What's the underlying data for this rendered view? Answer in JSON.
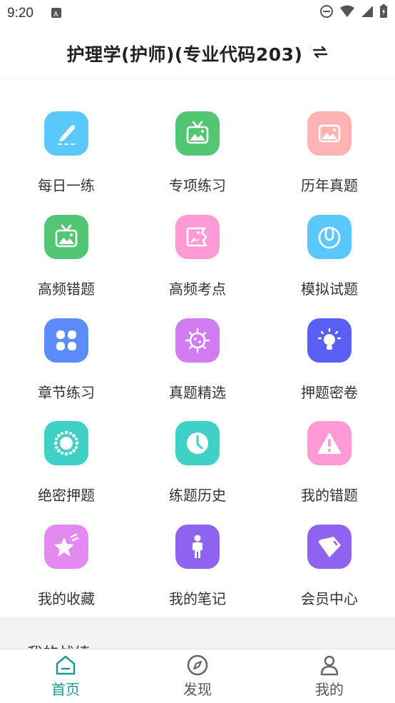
{
  "status_bar": {
    "time": "9:20"
  },
  "header": {
    "title": "护理学(护师)(专业代码203)",
    "switch_icon": "swap-arrows-icon"
  },
  "grid": [
    {
      "label": "每日一练",
      "icon": "pen-icon",
      "color": "#5ac8fa"
    },
    {
      "label": "专项练习",
      "icon": "tv-icon",
      "color": "#52c673"
    },
    {
      "label": "历年真题",
      "icon": "picture-icon",
      "color": "#ffb3b3"
    },
    {
      "label": "高频错题",
      "icon": "tv-icon",
      "color": "#52c673"
    },
    {
      "label": "高频考点",
      "icon": "broken-picture-icon",
      "color": "#ff9ad5"
    },
    {
      "label": "模拟试题",
      "icon": "mouse-icon",
      "color": "#5ac8fa"
    },
    {
      "label": "章节练习",
      "icon": "four-squares-icon",
      "color": "#5b8cf7"
    },
    {
      "label": "真题精选",
      "icon": "virus-icon",
      "color": "#d27cf2"
    },
    {
      "label": "押题密卷",
      "icon": "lightbulb-icon",
      "color": "#5b5ef5"
    },
    {
      "label": "绝密押题",
      "icon": "ring-icon",
      "color": "#3fd0c6"
    },
    {
      "label": "练题历史",
      "icon": "clock-icon",
      "color": "#3fd0c6"
    },
    {
      "label": "我的错题",
      "icon": "warning-icon",
      "color": "#ff9ad5"
    },
    {
      "label": "我的收藏",
      "icon": "star-icon",
      "color": "#e28af0"
    },
    {
      "label": "我的笔记",
      "icon": "person-icon",
      "color": "#8e63f0"
    },
    {
      "label": "会员中心",
      "icon": "diamond-icon",
      "color": "#8e63f0"
    }
  ],
  "section": {
    "title": "我的战绩"
  },
  "tabs": [
    {
      "label": "首页",
      "icon": "home-icon",
      "active": true
    },
    {
      "label": "发现",
      "icon": "compass-icon",
      "active": false
    },
    {
      "label": "我的",
      "icon": "user-icon",
      "active": false
    }
  ],
  "colors": {
    "accent": "#1a9c8e"
  }
}
